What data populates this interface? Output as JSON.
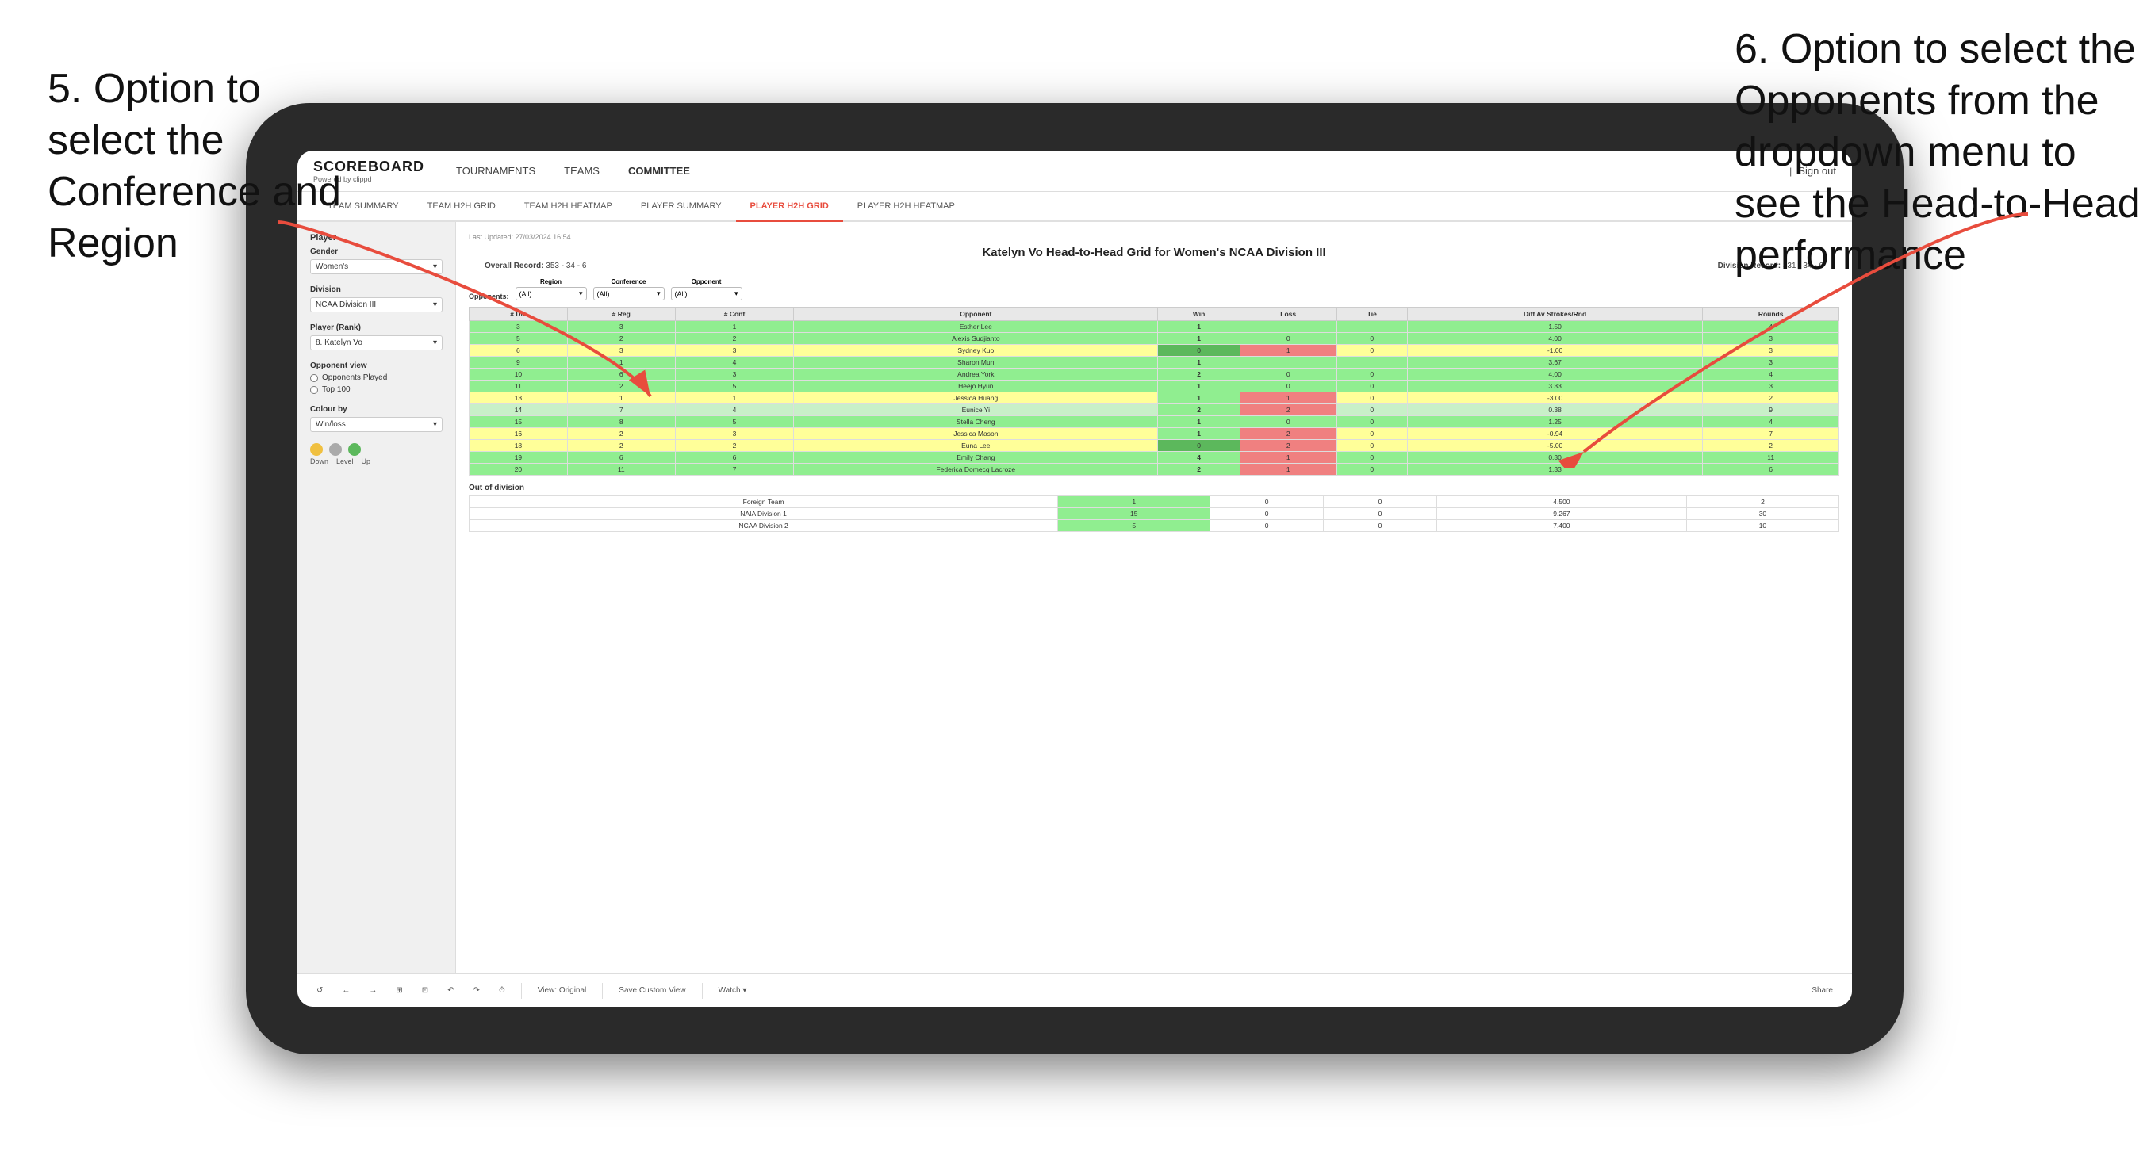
{
  "annotations": {
    "left": "5. Option to select the Conference and Region",
    "right": "6. Option to select the Opponents from the dropdown menu to see the Head-to-Head performance"
  },
  "nav": {
    "logo": "SCOREBOARD",
    "logo_sub": "Powered by clippd",
    "items": [
      "TOURNAMENTS",
      "TEAMS",
      "COMMITTEE"
    ],
    "active_item": "COMMITTEE",
    "sign_out": "Sign out"
  },
  "sub_tabs": [
    "TEAM SUMMARY",
    "TEAM H2H GRID",
    "TEAM H2H HEATMAP",
    "PLAYER SUMMARY",
    "PLAYER H2H GRID",
    "PLAYER H2H HEATMAP"
  ],
  "active_sub_tab": "PLAYER H2H GRID",
  "sidebar": {
    "player_title": "Player",
    "gender_label": "Gender",
    "gender_value": "Women's",
    "division_label": "Division",
    "division_value": "NCAA Division III",
    "player_rank_label": "Player (Rank)",
    "player_rank_value": "8. Katelyn Vo",
    "opponent_view_label": "Opponent view",
    "opponent_options": [
      "Opponents Played",
      "Top 100"
    ],
    "colour_by_label": "Colour by",
    "colour_by_value": "Win/loss",
    "circle_labels": [
      "Down",
      "Level",
      "Up"
    ]
  },
  "content": {
    "last_updated": "Last Updated: 27/03/2024 16:54",
    "title": "Katelyn Vo Head-to-Head Grid for Women's NCAA Division III",
    "overall_record_label": "Overall Record:",
    "overall_record": "353 - 34 - 6",
    "division_record_label": "Division Record:",
    "division_record": "331 - 34 - 6",
    "filter": {
      "region_label": "Region",
      "conference_label": "Conference",
      "opponent_label": "Opponent",
      "opponents_label": "Opponents:",
      "region_value": "(All)",
      "conference_value": "(All)",
      "opponent_value": "(All)"
    },
    "table_headers": [
      "# Div",
      "# Reg",
      "# Conf",
      "Opponent",
      "Win",
      "Loss",
      "Tie",
      "Diff Av Strokes/Rnd",
      "Rounds"
    ],
    "table_rows": [
      {
        "div": "3",
        "reg": "3",
        "conf": "1",
        "opponent": "Esther Lee",
        "win": "1",
        "loss": "",
        "tie": "",
        "diff": "1.50",
        "rounds": "4",
        "row_class": "row-green"
      },
      {
        "div": "5",
        "reg": "2",
        "conf": "2",
        "opponent": "Alexis Sudjianto",
        "win": "1",
        "loss": "0",
        "tie": "0",
        "diff": "4.00",
        "rounds": "3",
        "row_class": "row-green"
      },
      {
        "div": "6",
        "reg": "3",
        "conf": "3",
        "opponent": "Sydney Kuo",
        "win": "0",
        "loss": "1",
        "tie": "0",
        "diff": "-1.00",
        "rounds": "3",
        "row_class": "row-yellow"
      },
      {
        "div": "9",
        "reg": "1",
        "conf": "4",
        "opponent": "Sharon Mun",
        "win": "1",
        "loss": "",
        "tie": "",
        "diff": "3.67",
        "rounds": "3",
        "row_class": "row-green"
      },
      {
        "div": "10",
        "reg": "6",
        "conf": "3",
        "opponent": "Andrea York",
        "win": "2",
        "loss": "0",
        "tie": "0",
        "diff": "4.00",
        "rounds": "4",
        "row_class": "row-green"
      },
      {
        "div": "11",
        "reg": "2",
        "conf": "5",
        "opponent": "Heejo Hyun",
        "win": "1",
        "loss": "0",
        "tie": "0",
        "diff": "3.33",
        "rounds": "3",
        "row_class": "row-green"
      },
      {
        "div": "13",
        "reg": "1",
        "conf": "1",
        "opponent": "Jessica Huang",
        "win": "1",
        "loss": "1",
        "tie": "0",
        "diff": "-3.00",
        "rounds": "2",
        "row_class": "row-yellow"
      },
      {
        "div": "14",
        "reg": "7",
        "conf": "4",
        "opponent": "Eunice Yi",
        "win": "2",
        "loss": "2",
        "tie": "0",
        "diff": "0.38",
        "rounds": "9",
        "row_class": "row-light-green"
      },
      {
        "div": "15",
        "reg": "8",
        "conf": "5",
        "opponent": "Stella Cheng",
        "win": "1",
        "loss": "0",
        "tie": "0",
        "diff": "1.25",
        "rounds": "4",
        "row_class": "row-green"
      },
      {
        "div": "16",
        "reg": "2",
        "conf": "3",
        "opponent": "Jessica Mason",
        "win": "1",
        "loss": "2",
        "tie": "0",
        "diff": "-0.94",
        "rounds": "7",
        "row_class": "row-yellow"
      },
      {
        "div": "18",
        "reg": "2",
        "conf": "2",
        "opponent": "Euna Lee",
        "win": "0",
        "loss": "2",
        "tie": "0",
        "diff": "-5.00",
        "rounds": "2",
        "row_class": "row-yellow"
      },
      {
        "div": "19",
        "reg": "6",
        "conf": "6",
        "opponent": "Emily Chang",
        "win": "4",
        "loss": "1",
        "tie": "0",
        "diff": "0.30",
        "rounds": "11",
        "row_class": "row-green"
      },
      {
        "div": "20",
        "reg": "11",
        "conf": "7",
        "opponent": "Federica Domecq Lacroze",
        "win": "2",
        "loss": "1",
        "tie": "0",
        "diff": "1.33",
        "rounds": "6",
        "row_class": "row-green"
      }
    ],
    "out_of_division_title": "Out of division",
    "out_of_division_rows": [
      {
        "opponent": "Foreign Team",
        "win": "1",
        "loss": "0",
        "tie": "0",
        "diff": "4.500",
        "rounds": "2"
      },
      {
        "opponent": "NAIA Division 1",
        "win": "15",
        "loss": "0",
        "tie": "0",
        "diff": "9.267",
        "rounds": "30"
      },
      {
        "opponent": "NCAA Division 2",
        "win": "5",
        "loss": "0",
        "tie": "0",
        "diff": "7.400",
        "rounds": "10"
      }
    ]
  },
  "toolbar": {
    "buttons": [
      "↺",
      "←",
      "→",
      "⊞",
      "⊡",
      "↶",
      "↷",
      "⏱",
      "View: Original",
      "Save Custom View",
      "Watch ▾",
      "⊞",
      "⊡",
      "Share"
    ]
  }
}
